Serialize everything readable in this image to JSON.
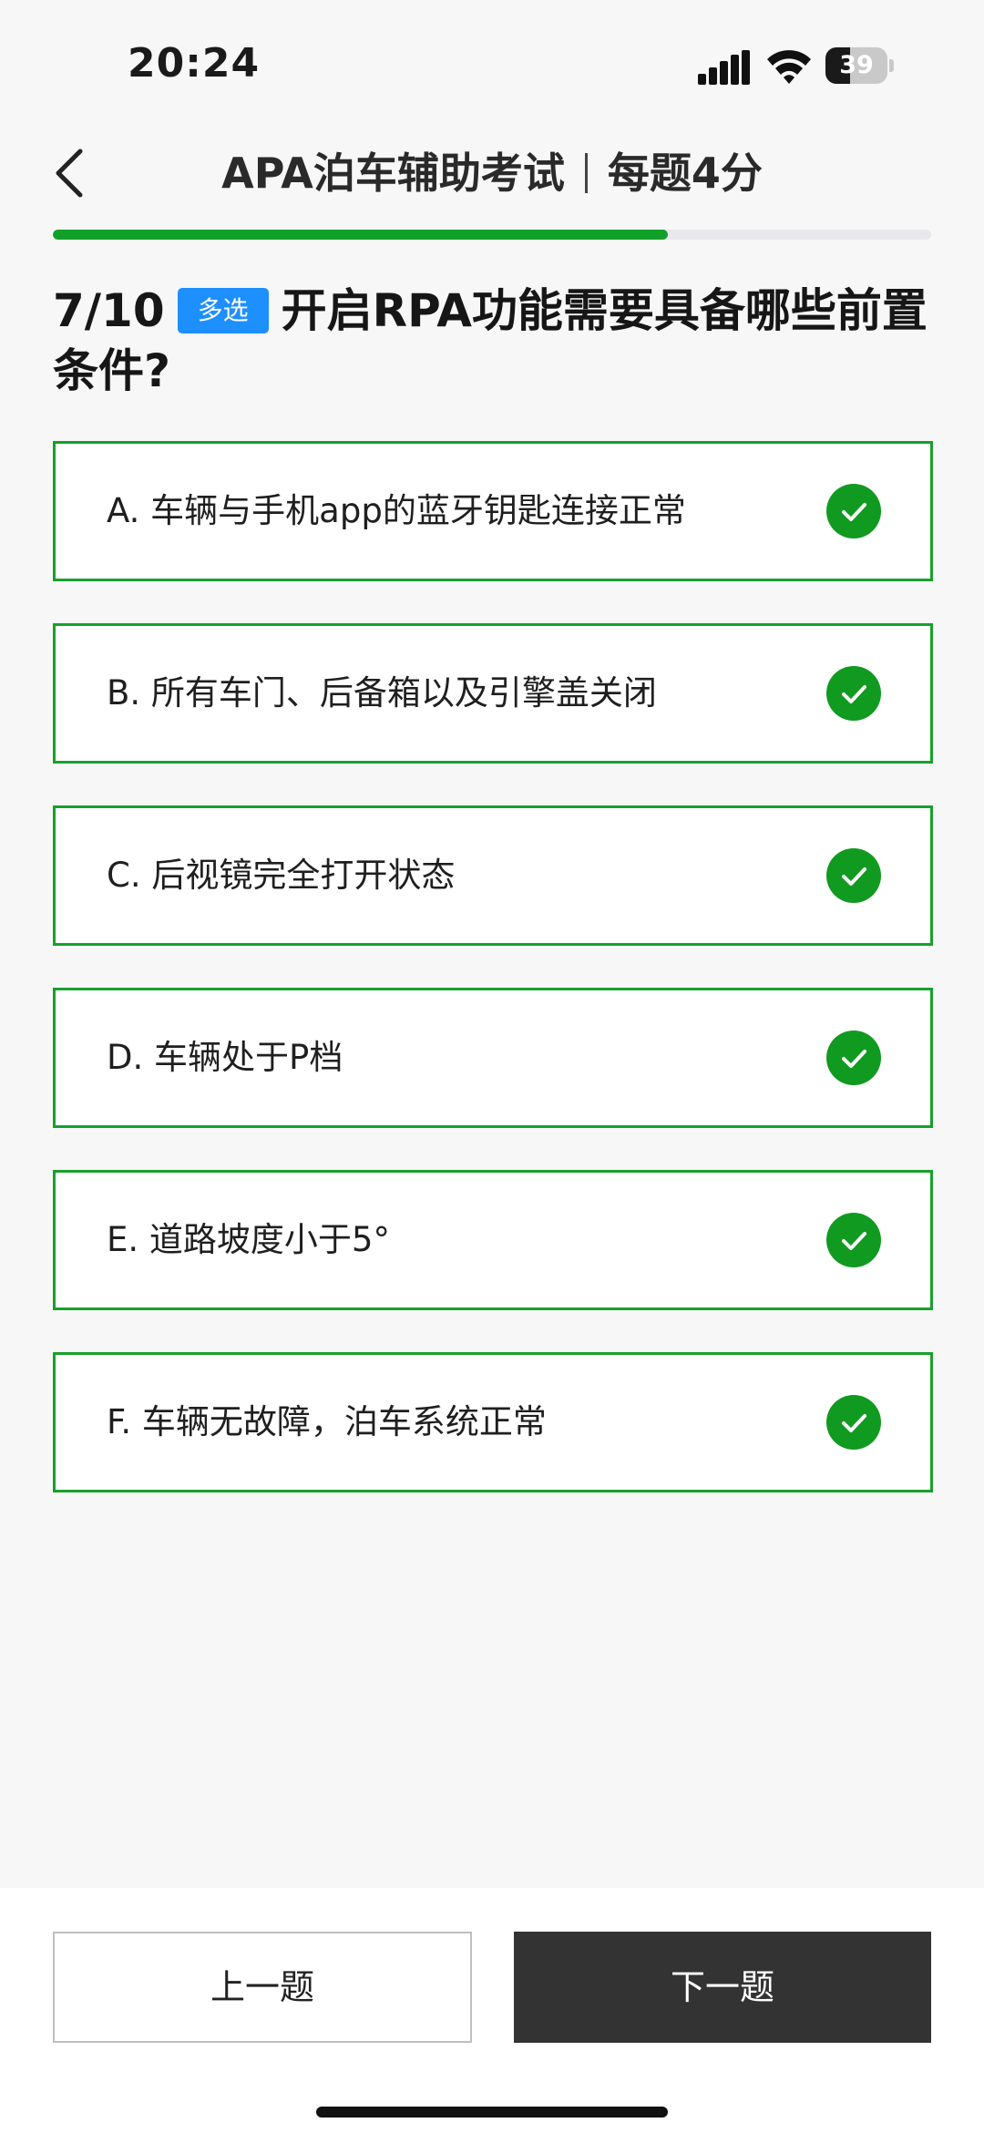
{
  "status_bar": {
    "time": "20:24",
    "battery_level": "39",
    "battery_fraction": 0.39,
    "icons": [
      "signal-icon",
      "wifi-icon",
      "battery-icon"
    ]
  },
  "header": {
    "title_main": "APA泊车辅助考试",
    "title_sub": "每题4分",
    "back_icon": "chevron-left-icon"
  },
  "progress": {
    "current": 7,
    "total": 10,
    "fraction": 0.7
  },
  "question": {
    "number": "7/10",
    "type_tag": "多选",
    "text": "开启RPA功能需要具备哪些前置条件?"
  },
  "options": [
    {
      "label": "A. 车辆与手机app的蓝牙钥匙连接正常",
      "selected": true
    },
    {
      "label": "B. 所有车门、后备箱以及引擎盖关闭",
      "selected": true
    },
    {
      "label": "C. 后视镜完全打开状态",
      "selected": true
    },
    {
      "label": "D. 车辆处于P档",
      "selected": true
    },
    {
      "label": "E. 道路坡度小于5°",
      "selected": true
    },
    {
      "label": "F. 车辆无故障，泊车系统正常",
      "selected": true
    }
  ],
  "footer": {
    "prev_label": "上一题",
    "next_label": "下一题"
  },
  "colors": {
    "accent_green": "#13a02a",
    "tag_blue": "#1e8fff",
    "next_button": "#333333"
  }
}
